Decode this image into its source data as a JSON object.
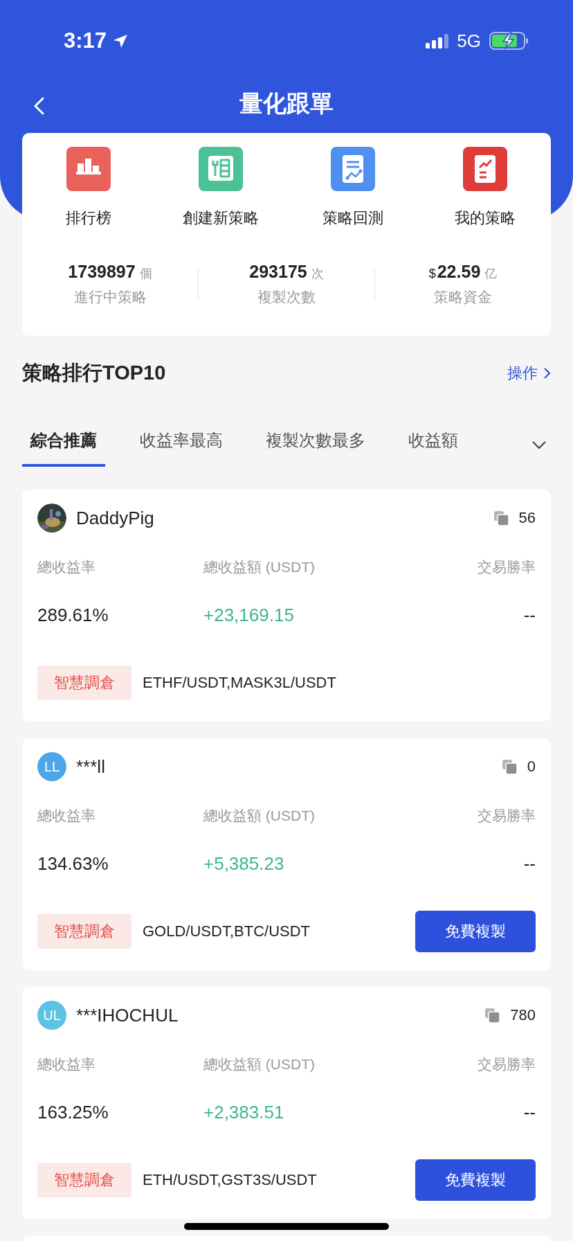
{
  "status_bar": {
    "time": "3:17",
    "network": "5G"
  },
  "header": {
    "title": "量化跟單"
  },
  "shortcuts": [
    {
      "kind": "ranking",
      "label": "排行榜"
    },
    {
      "kind": "create",
      "label": "創建新策略"
    },
    {
      "kind": "backtest",
      "label": "策略回測"
    },
    {
      "kind": "mine",
      "label": "我的策略"
    }
  ],
  "stats": [
    {
      "value": "1739897",
      "unit": "個",
      "label": "進行中策略"
    },
    {
      "value": "293175",
      "unit": "次",
      "label": "複製次數"
    },
    {
      "prefix": "$",
      "value": "22.59",
      "unit": "亿",
      "label": "策略資金"
    }
  ],
  "section": {
    "title": "策略排行TOP10",
    "action": "操作"
  },
  "tabs": [
    {
      "label": "綜合推薦",
      "selected": true
    },
    {
      "label": "收益率最高",
      "selected": false
    },
    {
      "label": "複製次數最多",
      "selected": false
    },
    {
      "label": "收益額",
      "selected": false
    }
  ],
  "strategies": [
    {
      "avatar": {
        "kind": "picture"
      },
      "name": "DaddyPig",
      "copies": "56",
      "labels": [
        "總收益率",
        "總收益額 (USDT)",
        "交易勝率"
      ],
      "rate": "289.61%",
      "profit": "+23,169.15",
      "win_rate": "--",
      "tag": "智慧調倉",
      "pairs": "ETHF/USDT,MASK3L/USDT"
    },
    {
      "avatar": {
        "kind": "initials",
        "text": "LL",
        "color": "#4ea6ea"
      },
      "name": "***ll",
      "copies": "0",
      "labels": [
        "總收益率",
        "總收益額 (USDT)",
        "交易勝率"
      ],
      "rate": "134.63%",
      "profit": "+5,385.23",
      "win_rate": "--",
      "tag": "智慧調倉",
      "pairs": "GOLD/USDT,BTC/USDT",
      "button": "免費複製"
    },
    {
      "avatar": {
        "kind": "initials",
        "text": "UL",
        "color": "#5bc3e3"
      },
      "name": "***IHOCHUL",
      "copies": "780",
      "labels": [
        "總收益率",
        "總收益額 (USDT)",
        "交易勝率"
      ],
      "rate": "163.25%",
      "profit": "+2,383.51",
      "win_rate": "--",
      "tag": "智慧調倉",
      "pairs": "ETH/USDT,GST3S/USDT",
      "button": "免費複製"
    }
  ]
}
